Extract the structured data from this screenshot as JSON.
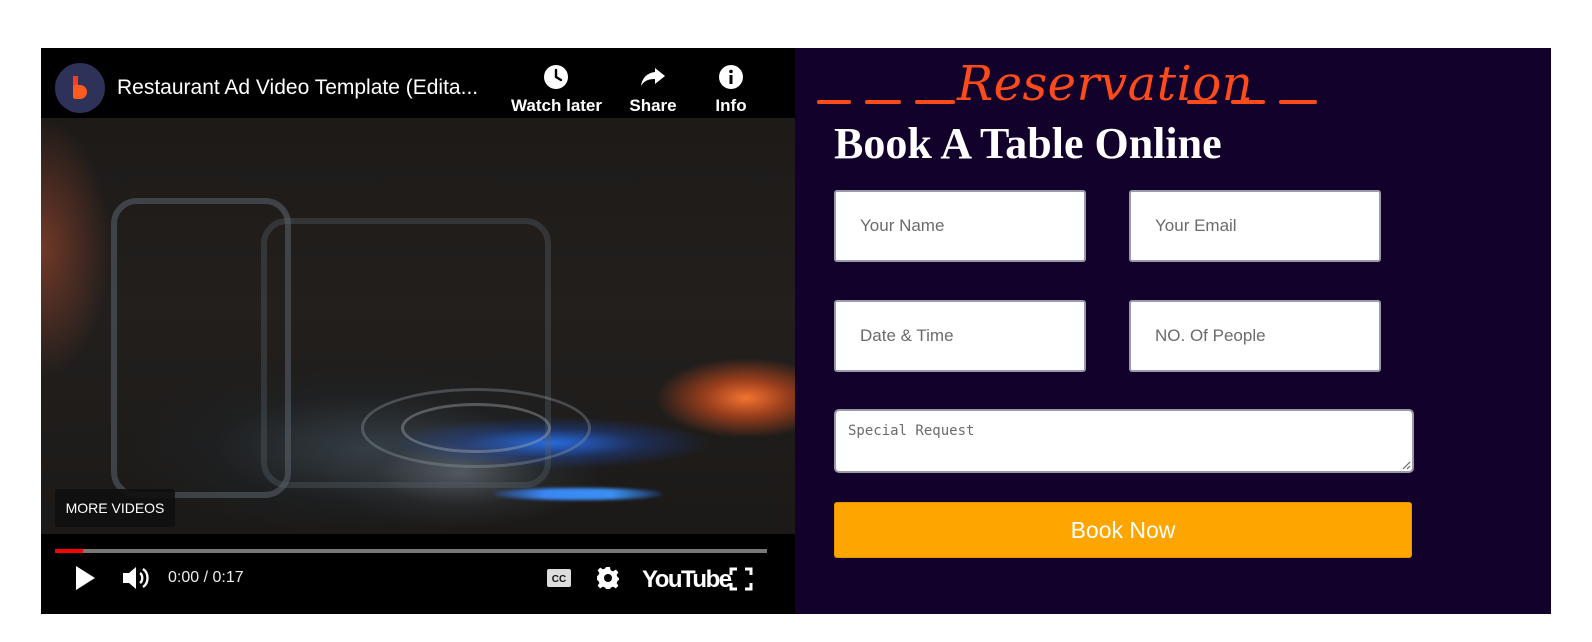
{
  "video": {
    "title": "Restaurant Ad Video Template (Edita...",
    "channel_avatar_icon": "bubble-b-logo-icon",
    "actions": [
      {
        "label": "Watch later",
        "icon": "clock-icon"
      },
      {
        "label": "Share",
        "icon": "share-arrow-icon"
      },
      {
        "label": "Info",
        "icon": "info-icon"
      }
    ],
    "more_videos_label": "MORE VIDEOS",
    "time": "0:00 / 0:17",
    "progress_fraction": 0.04,
    "youtube_wordmark": "YouTube",
    "control_icons": [
      "play-icon",
      "volume-icon",
      "captions-icon",
      "settings-icon",
      "fullscreen-icon"
    ],
    "colors": {
      "progress": "#ff0000",
      "background": "#000000"
    }
  },
  "reservation": {
    "kicker": "Reservation",
    "title": "Book A Table Online",
    "fields": {
      "name_placeholder": "Your Name",
      "email_placeholder": "Your Email",
      "datetime_placeholder": "Date & Time",
      "people_placeholder": "NO. Of People",
      "special_placeholder": "Special Request"
    },
    "submit_label": "Book Now",
    "colors": {
      "panel": "#12012a",
      "accent": "#ff4a1c",
      "button": "#ffa500"
    }
  }
}
